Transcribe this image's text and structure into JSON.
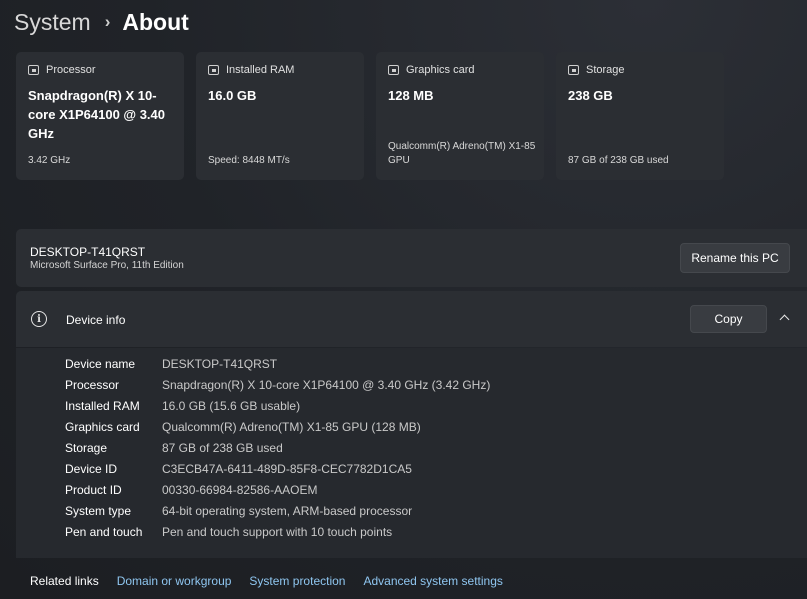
{
  "breadcrumb": {
    "parent": "System",
    "separator": "›",
    "current": "About"
  },
  "specs": [
    {
      "label": "Processor",
      "icon": "processor-icon",
      "value": "Snapdragon(R) X 10-core X1P64100 @ 3.40 GHz",
      "sub": "3.42 GHz"
    },
    {
      "label": "Installed RAM",
      "icon": "ram-icon",
      "value": "16.0 GB",
      "sub": "Speed: 8448 MT/s"
    },
    {
      "label": "Graphics card",
      "icon": "graphics-card-icon",
      "value": "128 MB",
      "sub": "Qualcomm(R) Adreno(TM) X1-85 GPU"
    },
    {
      "label": "Storage",
      "icon": "storage-icon",
      "value": "238 GB",
      "sub": "87 GB of 238 GB used"
    }
  ],
  "pc": {
    "name": "DESKTOP-T41QRST",
    "model": "Microsoft Surface Pro, 11th Edition",
    "rename_label": "Rename this PC"
  },
  "device_info": {
    "title": "Device info",
    "copy_label": "Copy",
    "rows": [
      {
        "label": "Device name",
        "value": "DESKTOP-T41QRST"
      },
      {
        "label": "Processor",
        "value": "Snapdragon(R) X 10-core X1P64100 @ 3.40 GHz (3.42 GHz)"
      },
      {
        "label": "Installed RAM",
        "value": "16.0 GB (15.6 GB usable)"
      },
      {
        "label": "Graphics card",
        "value": "Qualcomm(R) Adreno(TM) X1-85 GPU (128 MB)"
      },
      {
        "label": "Storage",
        "value": "87 GB of 238 GB used"
      },
      {
        "label": "Device ID",
        "value": "C3ECB47A-6411-489D-85F8-CEC7782D1CA5"
      },
      {
        "label": "Product ID",
        "value": "00330-66984-82586-AAOEM"
      },
      {
        "label": "System type",
        "value": "64-bit operating system, ARM-based processor"
      },
      {
        "label": "Pen and touch",
        "value": "Pen and touch support with 10 touch points"
      }
    ]
  },
  "related": {
    "label": "Related links",
    "links": [
      "Domain or workgroup",
      "System protection",
      "Advanced system settings"
    ]
  },
  "colors": {
    "link": "#8fc6f0",
    "card": "#2b2e33",
    "background": "#1f2227"
  }
}
